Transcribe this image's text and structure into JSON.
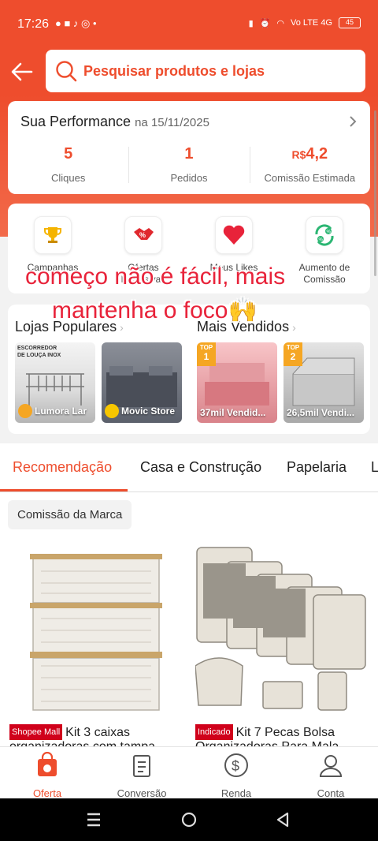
{
  "status": {
    "time": "17:26",
    "battery": "45",
    "net": "Vo LTE 4G"
  },
  "search": {
    "placeholder": "Pesquisar produtos e lojas"
  },
  "performance": {
    "title": "Sua Performance",
    "date": "na 15/11/2025",
    "stats": [
      {
        "value": "5",
        "label": "Cliques"
      },
      {
        "value": "1",
        "label": "Pedidos"
      },
      {
        "currency": "R$",
        "value": "4,2",
        "label": "Comissão Estimada"
      }
    ]
  },
  "quick_actions": [
    {
      "label_1": "Campanhas",
      "label_2": "",
      "icon": "trophy-icon"
    },
    {
      "label_1": "Ofertas",
      "label_2": "Exclusivas",
      "icon": "handshake-icon"
    },
    {
      "label_1": "Meus Likes",
      "label_2": "",
      "icon": "heart-icon"
    },
    {
      "label_1": "Aumento de",
      "label_2": "Comissão",
      "icon": "percent-cycle-icon"
    }
  ],
  "overlay": {
    "line1": "começo não é fácil, mais",
    "line2": "mantenha o foco🙌"
  },
  "popular": {
    "stores_title": "Lojas Populares",
    "sellers_title": "Mais Vendidos",
    "stores": [
      "Lumora Lar",
      "Movic Store"
    ],
    "sellers": [
      {
        "rank": "1",
        "label": "37mil Vendid..."
      },
      {
        "rank": "2",
        "label": "26,5mil Vendi..."
      }
    ],
    "top_label": "TOP",
    "tile_text": "ESCORREDOR DE LOUÇA INOX"
  },
  "tabs": [
    "Recomendação",
    "Casa e Construção",
    "Papelaria",
    "L"
  ],
  "chip": "Comissão da Marca",
  "products": [
    {
      "tag": "Shopee Mall",
      "title_1": "Kit 3 caixas",
      "title_2": "organizadoras com tampa"
    },
    {
      "tag": "Indicado",
      "title_1": "Kit 7 Pecas Bolsa",
      "title_2": "Organizadoras Para Mala"
    }
  ],
  "bottom_nav": [
    "Oferta",
    "Conversão",
    "Renda",
    "Conta"
  ],
  "colors": {
    "accent": "#ee4d2d"
  }
}
